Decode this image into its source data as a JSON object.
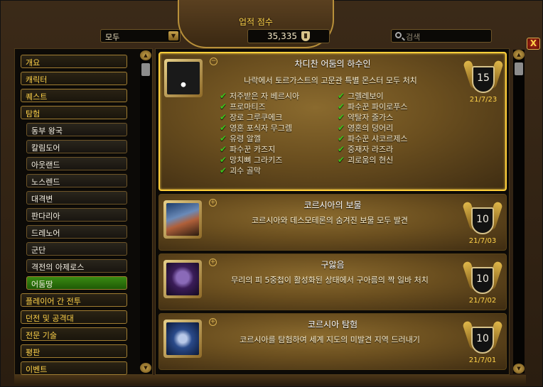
{
  "header": {
    "score_label": "업적 점수",
    "score_value": "35,335",
    "filter_value": "모두",
    "search_placeholder": "검색",
    "close_label": "X"
  },
  "sidebar": {
    "items": [
      {
        "label": "개요",
        "level": 0
      },
      {
        "label": "캐릭터",
        "level": 0
      },
      {
        "label": "퀘스트",
        "level": 0
      },
      {
        "label": "탐험",
        "level": 0
      },
      {
        "label": "동부 왕국",
        "level": 1
      },
      {
        "label": "칼림도어",
        "level": 1
      },
      {
        "label": "아웃랜드",
        "level": 1
      },
      {
        "label": "노스렌드",
        "level": 1
      },
      {
        "label": "대격변",
        "level": 1
      },
      {
        "label": "판다리아",
        "level": 1
      },
      {
        "label": "드레노어",
        "level": 1
      },
      {
        "label": "군단",
        "level": 1
      },
      {
        "label": "격전의 아제로스",
        "level": 1
      },
      {
        "label": "어둠땅",
        "level": 1,
        "active": true
      },
      {
        "label": "플레이어 간 전투",
        "level": 0
      },
      {
        "label": "던전 및 공격대",
        "level": 0
      },
      {
        "label": "전문 기술",
        "level": 0
      },
      {
        "label": "평판",
        "level": 0
      },
      {
        "label": "이벤트",
        "level": 0
      }
    ]
  },
  "achievements": [
    {
      "title": "차디찬 어둠의 하수인",
      "description": "나락에서 토르가스트의 고문관 특별 몬스터 모두 처치",
      "points": "15",
      "date": "21/7/23",
      "toggle": "−",
      "criteria_left": [
        "저주받은 자 베르시아",
        "프로마티즈",
        "장로 그루쿠에크",
        "영혼 포식자 무그렘",
        "유령 알껠",
        "파수꾼 카즈지",
        "망치뼈 그라키즈",
        "괴수 골막"
      ],
      "criteria_right": [
        "그렐레보이",
        "파수꾼 파이로푸스",
        "약탈자 줄가스",
        "영혼의 덩어리",
        "파수꾼 샤코르제스",
        "중재자 라즈라",
        "괴로움의 현신"
      ]
    },
    {
      "title": "코르시아의 보물",
      "description": "코르시아와 데스모테론의 숨겨진 보물 모두 발견",
      "points": "10",
      "date": "21/7/03",
      "toggle": "+"
    },
    {
      "title": "구앓음",
      "description": "무리의 피 5중첩이 활성화된 상태에서 구아름의 짝 일바 처치",
      "points": "10",
      "date": "21/7/02",
      "toggle": "+"
    },
    {
      "title": "코르시아 탐험",
      "description": "코르시아를 탐험하여 세계 지도의 미발견 지역 드러내기",
      "points": "10",
      "date": "21/7/01",
      "toggle": "+"
    }
  ],
  "colors": {
    "gold": "#ffd34a",
    "active_green": "#3a8a12",
    "check_green": "#3cc31c"
  }
}
